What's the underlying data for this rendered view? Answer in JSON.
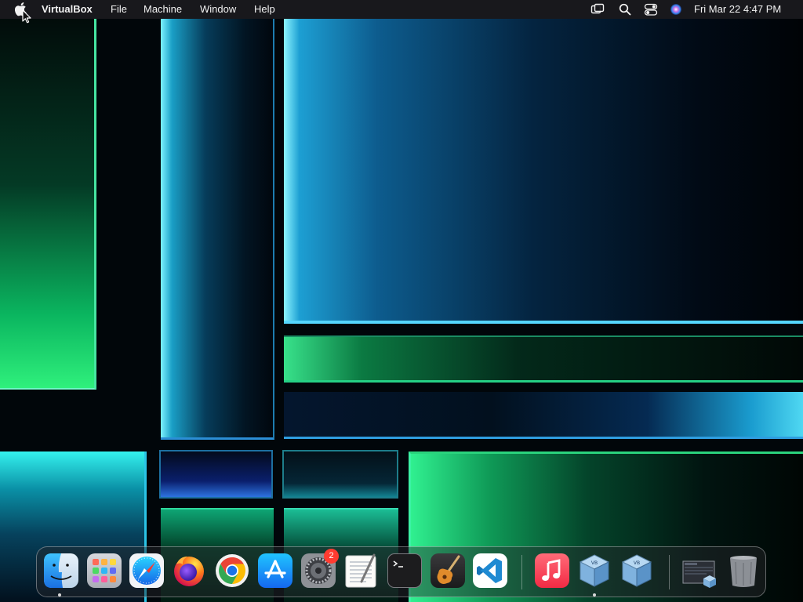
{
  "menubar": {
    "app_name": "VirtualBox",
    "menus": [
      "File",
      "Machine",
      "Window",
      "Help"
    ],
    "status_icons": [
      "screen-mirroring-icon",
      "spotlight-search-icon",
      "control-center-icon",
      "siri-icon"
    ],
    "clock": "Fri Mar 22  4:47 PM"
  },
  "dock": {
    "apps": [
      {
        "name": "Finder",
        "icon": "finder-icon",
        "running": true
      },
      {
        "name": "Launchpad",
        "icon": "launchpad-icon",
        "running": false
      },
      {
        "name": "Safari",
        "icon": "safari-icon",
        "running": false
      },
      {
        "name": "Firefox",
        "icon": "firefox-icon",
        "running": false
      },
      {
        "name": "Google Chrome",
        "icon": "chrome-icon",
        "running": false
      },
      {
        "name": "App Store",
        "icon": "app-store-icon",
        "running": false
      },
      {
        "name": "System Settings",
        "icon": "system-settings-icon",
        "running": false,
        "badge": "2"
      },
      {
        "name": "TextEdit",
        "icon": "textedit-icon",
        "running": false
      },
      {
        "name": "Terminal",
        "icon": "terminal-icon",
        "running": false
      },
      {
        "name": "GarageBand",
        "icon": "garageband-icon",
        "running": false
      },
      {
        "name": "Visual Studio Code",
        "icon": "vscode-icon",
        "running": false
      },
      {
        "name": "Music",
        "icon": "music-icon",
        "running": false
      },
      {
        "name": "VirtualBox",
        "icon": "virtualbox-icon",
        "running": true
      },
      {
        "name": "VirtualBox VM",
        "icon": "virtualbox-vm-icon",
        "running": false
      }
    ],
    "stack_icon": "downloads-stack-icon",
    "trash_icon": "trash-icon"
  },
  "colors": {
    "menubar_bg": "#1a1a1e",
    "badge": "#ff3b30",
    "wallpaper_accent_cyan": "#55d6ff",
    "wallpaper_accent_green": "#2ff07c"
  }
}
